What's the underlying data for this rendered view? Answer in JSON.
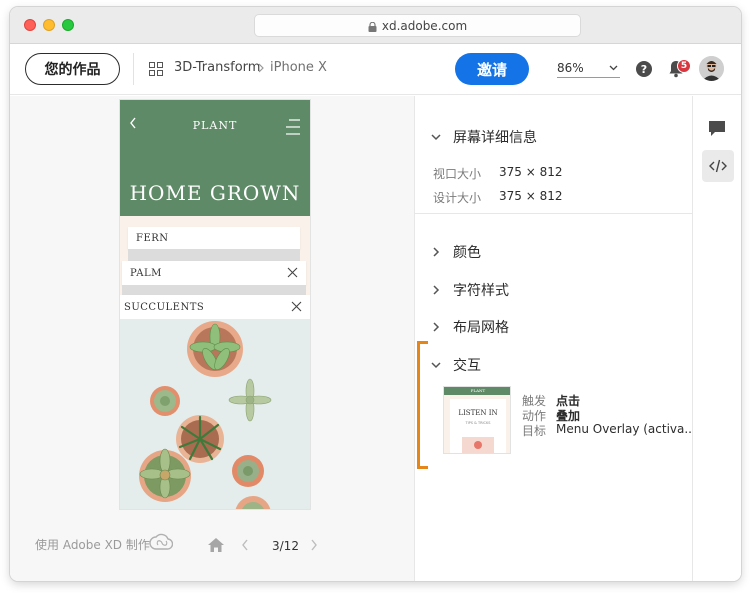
{
  "browser": {
    "url": "xd.adobe.com"
  },
  "header": {
    "my_work_label": "您的作品",
    "breadcrumb_project": "3D-Transform",
    "breadcrumb_artboard": "iPhone X",
    "invite_label": "邀请",
    "zoom_value": "86%",
    "help_label": "?",
    "notification_count": "5"
  },
  "artboard": {
    "brand": "PLANT",
    "hero_title": "HOME GROWN",
    "cards": [
      "FERN",
      "PALM",
      "SUCCULENTS"
    ],
    "colors": {
      "header_green": "#5f8a67",
      "background": "#faf1ea"
    }
  },
  "footer": {
    "made_with": "使用 Adobe XD 制作",
    "page_indicator": "3/12"
  },
  "inspector": {
    "screen_details": {
      "title": "屏幕详细信息",
      "viewport_label": "视口大小",
      "viewport_value": "375 × 812",
      "design_label": "设计大小",
      "design_value": "375 × 812"
    },
    "sections": {
      "colors": "颜色",
      "char_styles": "字符样式",
      "layout_grid": "布局网格",
      "interaction": "交互"
    },
    "interaction": {
      "trigger_label": "触发",
      "trigger_value": "点击",
      "action_label": "动作",
      "action_value": "叠加",
      "target_label": "目标",
      "target_value": "Menu Overlay (activa...",
      "thumbnail": {
        "brand": "PLANT",
        "title": "LISTEN IN",
        "subtitle": "TIPS & TRICKS"
      }
    }
  },
  "colors": {
    "accent_blue": "#1473e6",
    "highlight_orange": "#e68619",
    "badge_red": "#d7373f"
  }
}
